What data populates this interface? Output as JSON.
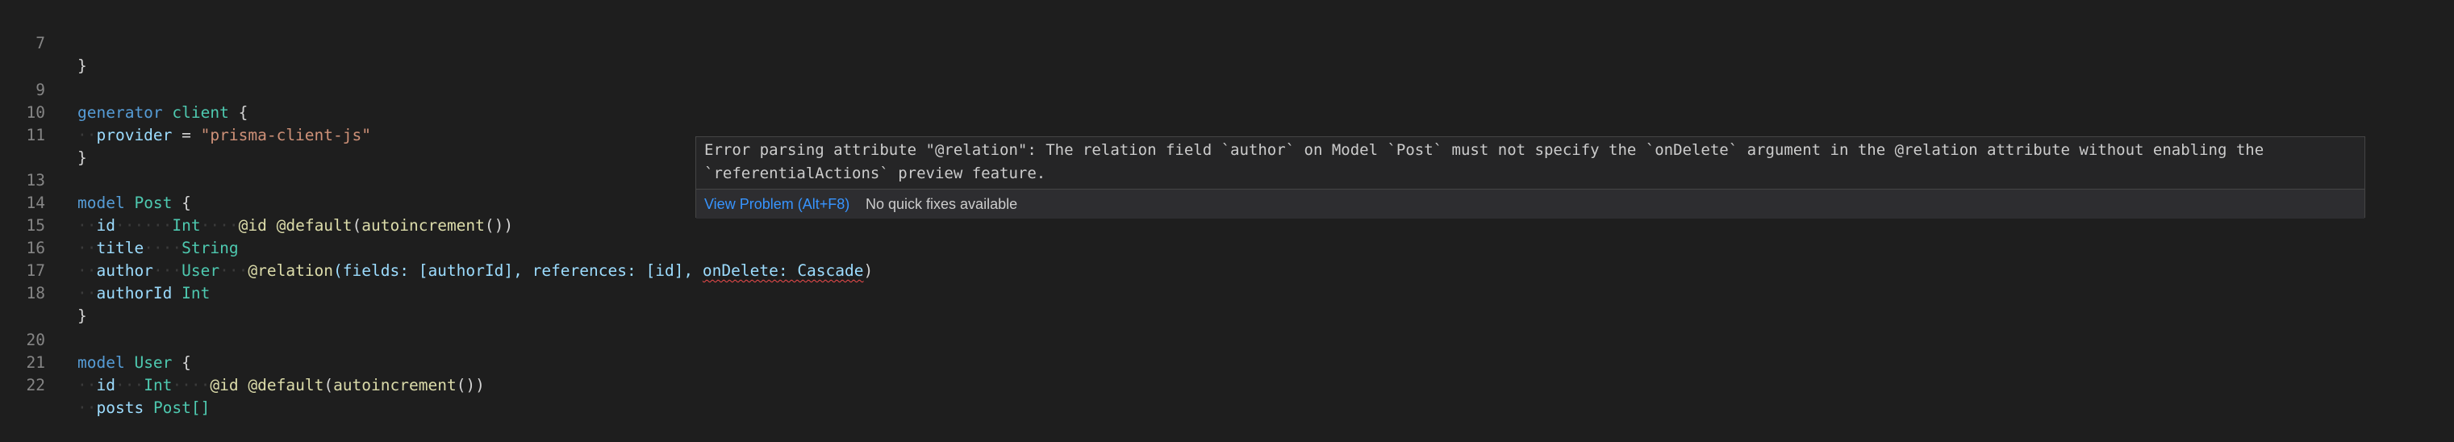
{
  "editor": {
    "lines": {
      "l7": {
        "num": "7",
        "brace": "}"
      },
      "l9": {
        "num": "9",
        "kw": "generator",
        "name": "client",
        "brace": "{"
      },
      "l10": {
        "num": "10",
        "field": "provider",
        "op": "=",
        "value": "\"prisma-client-js\""
      },
      "l11": {
        "num": "11",
        "brace": "}"
      },
      "l13": {
        "num": "13",
        "kw": "model",
        "name": "Post",
        "brace": "{"
      },
      "l14": {
        "num": "14",
        "field": "id",
        "type": "Int",
        "attr1": "@id",
        "attr2": "@default",
        "fn": "autoincrement",
        "rest": "())"
      },
      "l15": {
        "num": "15",
        "field": "title",
        "type": "String"
      },
      "l16": {
        "num": "16",
        "field": "author",
        "type": "User",
        "attr": "@relation",
        "args_before": "(fields: [authorId], references: [id], ",
        "err": "onDelete: Cascade",
        "close": ")"
      },
      "l17": {
        "num": "17",
        "field": "authorId",
        "type": "Int"
      },
      "l18": {
        "num": "18",
        "brace": "}"
      },
      "l20": {
        "num": "20",
        "kw": "model",
        "name": "User",
        "brace": "{"
      },
      "l21": {
        "num": "21",
        "field": "id",
        "type": "Int",
        "attr1": "@id",
        "attr2": "@default",
        "fn": "autoincrement",
        "rest": "())"
      },
      "l22": {
        "num": "22",
        "field": "posts",
        "type": "Post[]"
      }
    }
  },
  "hover": {
    "message": "Error parsing attribute \"@relation\": The relation field `author` on Model `Post` must not specify the `onDelete` argument in the @relation attribute without enabling the `referentialActions` preview feature.",
    "view_problem": "View Problem (Alt+F8)",
    "no_fixes": "No quick fixes available"
  }
}
